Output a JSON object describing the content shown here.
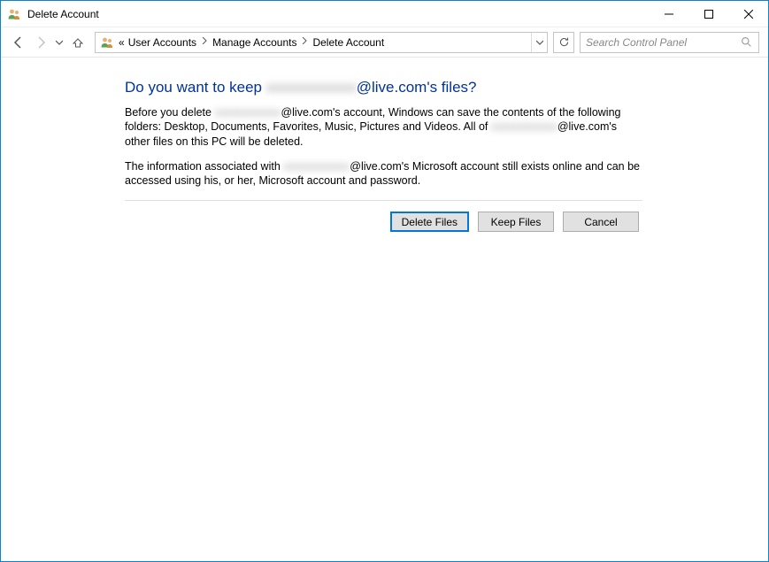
{
  "window": {
    "title": "Delete Account"
  },
  "breadcrumb": {
    "prefix": "«",
    "items": [
      "User Accounts",
      "Manage Accounts",
      "Delete Account"
    ]
  },
  "search": {
    "placeholder": "Search Control Panel"
  },
  "heading": {
    "prefix": "Do you want to keep ",
    "redacted": "xxxxxxxxxxxx",
    "suffix": "@live.com's files?"
  },
  "para1": {
    "t1": "Before you delete ",
    "r1": "xxxxxxxxxxxx",
    "t2": "@live.com's account, Windows can save the contents of the following folders: Desktop, Documents, Favorites, Music, Pictures and Videos. All of ",
    "r2": "xxxxxxxxxxxx",
    "t3": "@live.com's other files on this PC will be deleted."
  },
  "para2": {
    "t1": "The information associated with ",
    "r1": "xxxxxxxxxxxx",
    "t2": "@live.com's Microsoft account still exists online and can be accessed using his, or her, Microsoft account and password."
  },
  "buttons": {
    "delete": "Delete Files",
    "keep": "Keep Files",
    "cancel": "Cancel"
  }
}
